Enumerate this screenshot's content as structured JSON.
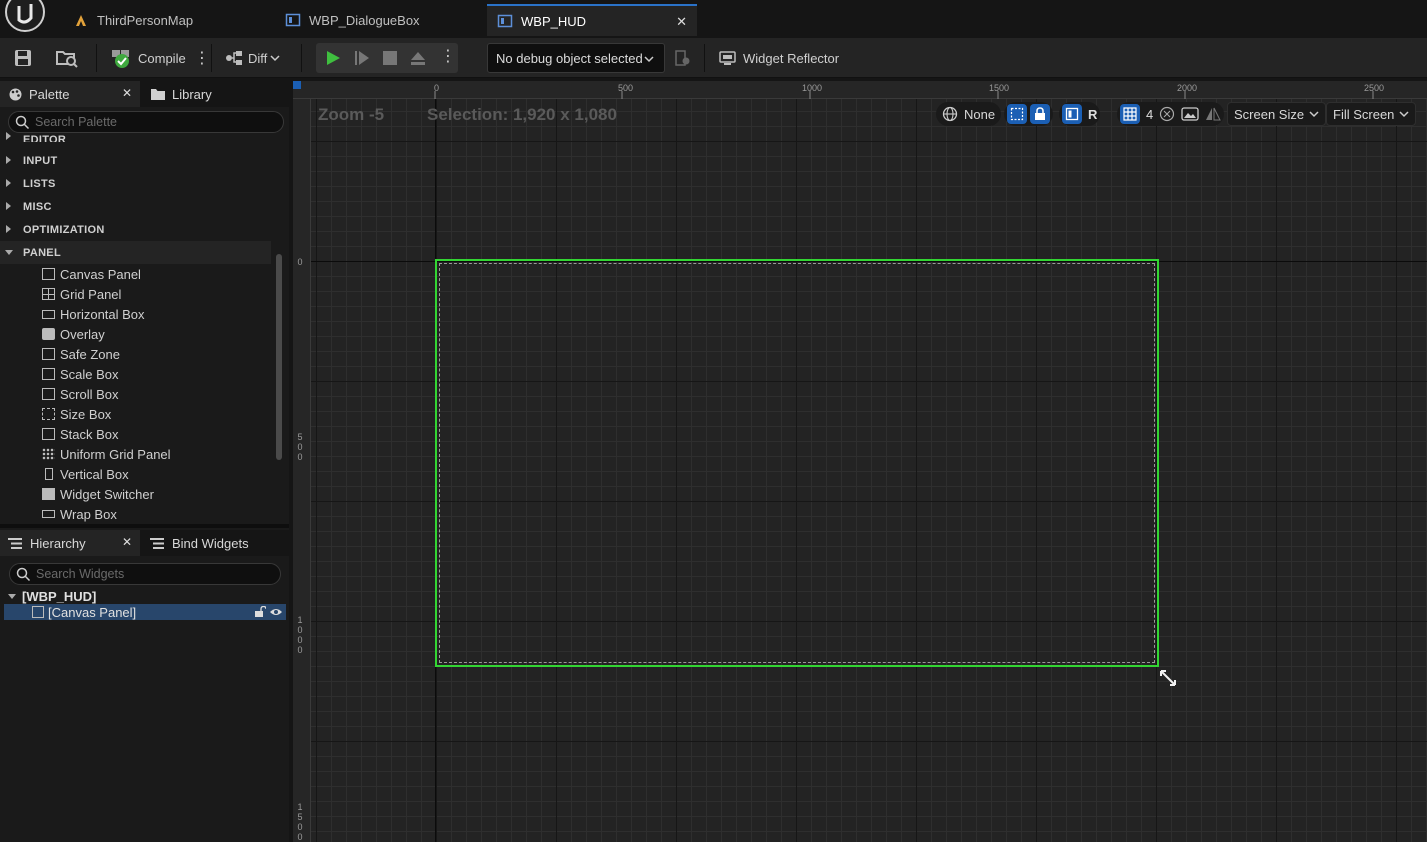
{
  "tabs": [
    {
      "label": "ThirdPersonMap"
    },
    {
      "label": "WBP_DialogueBox"
    },
    {
      "label": "WBP_HUD"
    }
  ],
  "toolbar": {
    "compile_label": "Compile",
    "diff_label": "Diff",
    "debug_object": "No debug object selected",
    "widget_reflector_label": "Widget Reflector"
  },
  "palette": {
    "tab_label": "Palette",
    "library_label": "Library",
    "search_placeholder": "Search Palette",
    "categories": [
      "EDITOR",
      "INPUT",
      "LISTS",
      "MISC",
      "OPTIMIZATION",
      "PANEL"
    ],
    "panel_items": [
      "Canvas Panel",
      "Grid Panel",
      "Horizontal Box",
      "Overlay",
      "Safe Zone",
      "Scale Box",
      "Scroll Box",
      "Size Box",
      "Stack Box",
      "Uniform Grid Panel",
      "Vertical Box",
      "Widget Switcher",
      "Wrap Box"
    ]
  },
  "hierarchy": {
    "tab_label": "Hierarchy",
    "bind_label": "Bind Widgets",
    "search_placeholder": "Search Widgets",
    "root": "[WBP_HUD]",
    "child": "[Canvas Panel]"
  },
  "viewport": {
    "zoom": "Zoom -5",
    "selection": "Selection: 1,920 x 1,080",
    "ruler_top": [
      "0",
      "500",
      "1000",
      "1500",
      "2000",
      "2500"
    ],
    "ruler_left": [
      "0",
      "500",
      "1000",
      "1500"
    ],
    "localization": "None",
    "r_label": "R",
    "grid_snap": "4",
    "screen_size": "Screen Size",
    "fill_screen": "Fill Screen"
  },
  "colors": {
    "accent_blue": "#1b5fb4",
    "play_green": "#3fbf3f",
    "selection_green": "#33d633"
  }
}
